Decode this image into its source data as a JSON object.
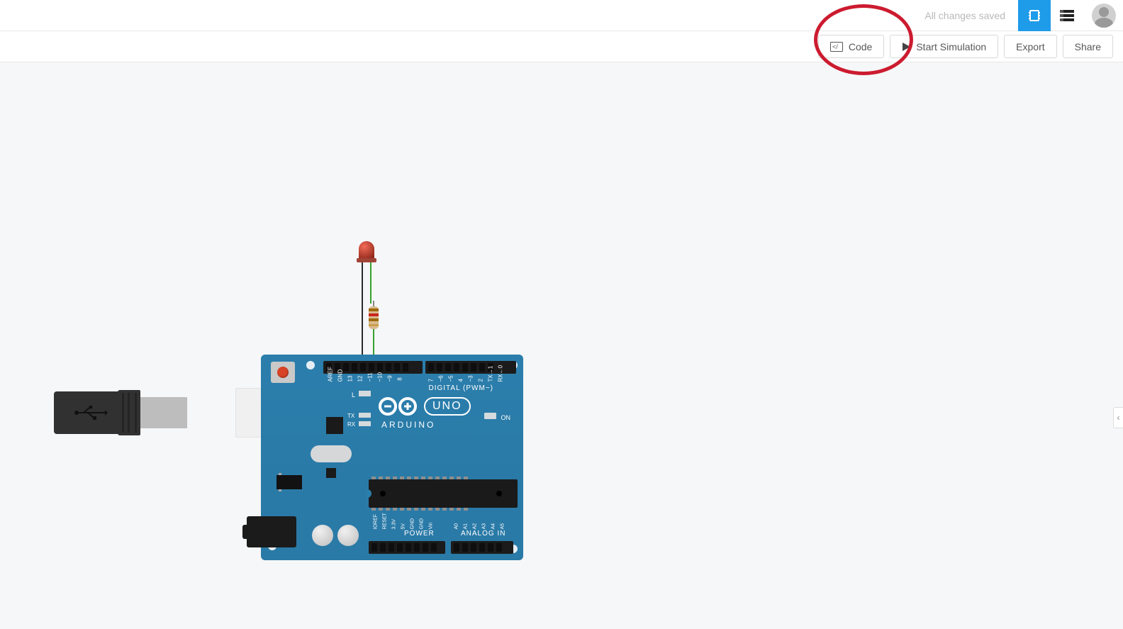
{
  "topbar": {
    "saved_status": "All changes saved"
  },
  "actions": {
    "code": "Code",
    "start_sim": "Start Simulation",
    "export": "Export",
    "share": "Share"
  },
  "board": {
    "brand": "ARDUINO",
    "model": "UNO",
    "digital_label": "DIGITAL (PWM~)",
    "power_label": "POWER",
    "analog_label": "ANALOG IN",
    "on_label": "ON",
    "l_label": "L",
    "tx_label": "TX",
    "rx_label": "RX",
    "top_pins_left": [
      "AREF",
      "GND",
      "13",
      "12",
      "~11",
      "~10",
      "~9",
      "8"
    ],
    "top_pins_right": [
      "7",
      "~6",
      "~5",
      "4",
      "~3",
      "2",
      "TX→1",
      "RX←0"
    ],
    "power_pins": [
      "IOREF",
      "RESET",
      "3.3V",
      "5V",
      "GND",
      "GND",
      "Vin"
    ],
    "analog_pins": [
      "A0",
      "A1",
      "A2",
      "A3",
      "A4",
      "A5"
    ]
  }
}
